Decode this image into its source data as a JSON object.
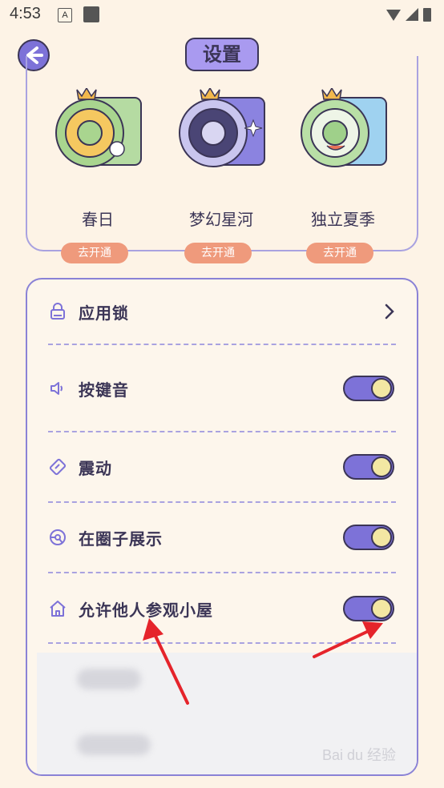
{
  "status_bar": {
    "time": "4:53",
    "a_icon": "A"
  },
  "header": {
    "title": "设置"
  },
  "themes": [
    {
      "name": "春日",
      "button": "去开通",
      "icon": "spring-theme-icon",
      "accent": "#9bcf7e"
    },
    {
      "name": "梦幻星河",
      "button": "去开通",
      "icon": "galaxy-theme-icon",
      "accent": "#8b83e0"
    },
    {
      "name": "独立夏季",
      "button": "去开通",
      "icon": "summer-theme-icon",
      "accent": "#7ec2ea"
    }
  ],
  "settings": {
    "rows": [
      {
        "label": "应用锁",
        "icon": "lock-icon",
        "control": "chevron"
      },
      {
        "label": "按键音",
        "icon": "speaker-icon",
        "control": "toggle",
        "on": true
      },
      {
        "label": "震动",
        "icon": "vibrate-icon",
        "control": "toggle",
        "on": true
      },
      {
        "label": "在圈子展示",
        "icon": "circle-icon",
        "control": "toggle",
        "on": true
      },
      {
        "label": "允许他人参观小屋",
        "icon": "house-icon",
        "control": "toggle",
        "on": true
      }
    ]
  },
  "watermark": "Bai du 经验",
  "colors": {
    "accent": "#7d72d8",
    "knob": "#f3e7a3",
    "button": "#ef9a7c",
    "background": "#fdf3e6",
    "annotation": "#e5242b"
  }
}
